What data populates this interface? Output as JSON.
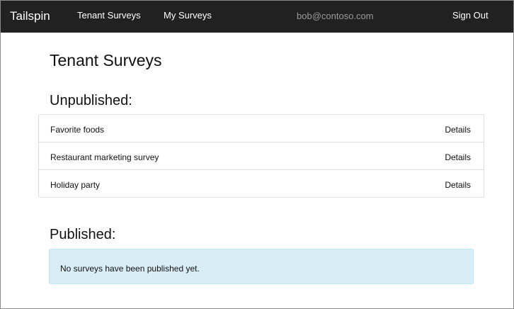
{
  "navbar": {
    "brand": "Tailspin",
    "links": [
      {
        "label": "Tenant Surveys"
      },
      {
        "label": "My Surveys"
      }
    ],
    "user": "bob@contoso.com",
    "sign_out": "Sign Out"
  },
  "main": {
    "title": "Tenant Surveys",
    "unpublished": {
      "heading": "Unpublished:",
      "surveys": [
        {
          "name": "Favorite foods",
          "action": "Details"
        },
        {
          "name": "Restaurant marketing survey",
          "action": "Details"
        },
        {
          "name": "Holiday party",
          "action": "Details"
        }
      ]
    },
    "published": {
      "heading": "Published:",
      "empty_message": "No surveys have been published yet."
    }
  },
  "colors": {
    "navbar_bg": "#212121",
    "info_bg": "#d9edf7",
    "user_text": "#9b9b9b"
  }
}
